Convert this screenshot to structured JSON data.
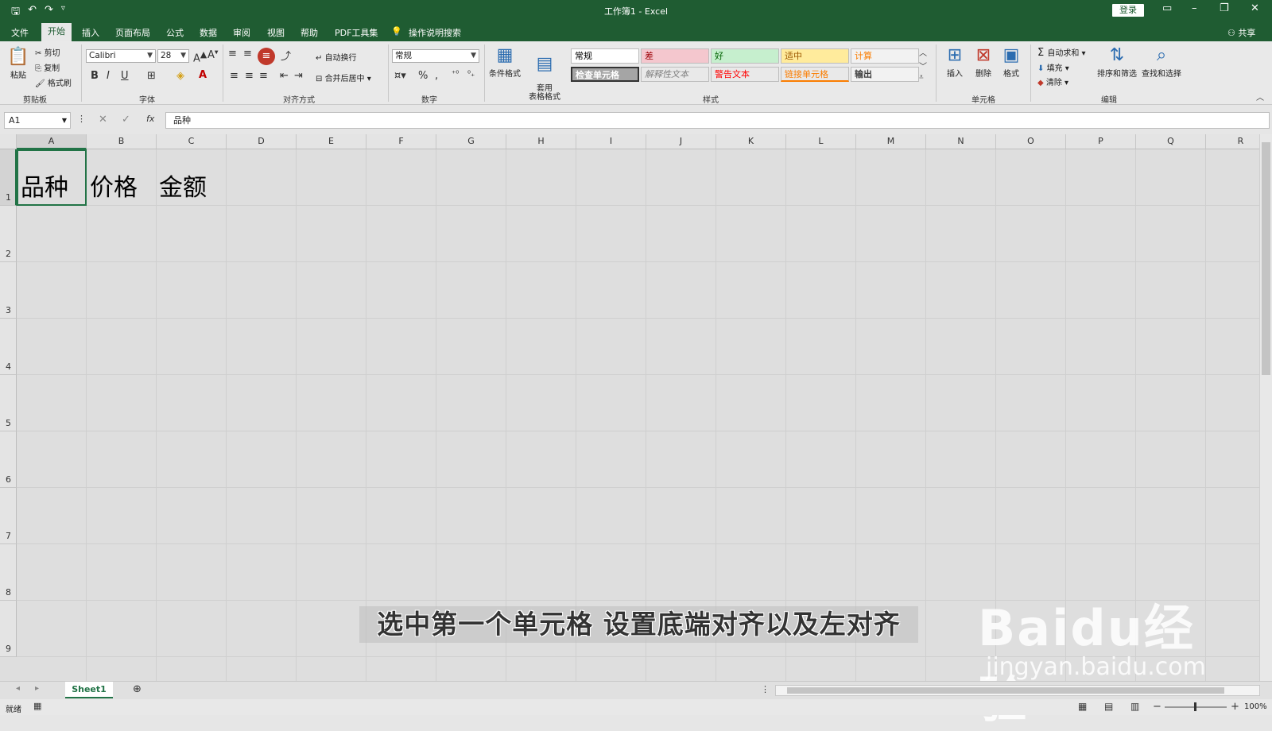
{
  "title_bar": {
    "title": "工作簿1 - Excel",
    "login": "登录"
  },
  "tabs": [
    "文件",
    "开始",
    "插入",
    "页面布局",
    "公式",
    "数据",
    "审阅",
    "视图",
    "帮助",
    "PDF工具集"
  ],
  "tell_me": "操作说明搜索",
  "share": "共享",
  "ribbon": {
    "clipboard": {
      "paste": "粘贴",
      "cut": "剪切",
      "copy": "复制",
      "format_painter": "格式刷",
      "label": "剪贴板"
    },
    "font": {
      "name": "Calibri",
      "size": "28",
      "label": "字体",
      "bold": "B",
      "italic": "I",
      "underline": "U"
    },
    "alignment": {
      "wrap": "自动换行",
      "merge": "合并后居中",
      "label": "对齐方式"
    },
    "number": {
      "format": "常规",
      "label": "数字",
      "percent": "%",
      "comma": ","
    },
    "styles": {
      "conditional": "条件格式",
      "table": "套用\n表格格式",
      "label": "样式",
      "cells": [
        {
          "text": "常规",
          "bg": "#ffffff",
          "color": "#000000"
        },
        {
          "text": "差",
          "bg": "#f4c7ce",
          "color": "#9c0006"
        },
        {
          "text": "好",
          "bg": "#c6efce",
          "color": "#006100"
        },
        {
          "text": "适中",
          "bg": "#ffeb9c",
          "color": "#9c5700"
        },
        {
          "text": "计算",
          "bg": "#f2f2f2",
          "color": "#fa7d00"
        },
        {
          "text": "检查单元格",
          "bg": "#a5a5a5",
          "color": "#ffffff"
        },
        {
          "text": "解释性文本",
          "bg": "#e9e9e9",
          "color": "#7f7f7f"
        },
        {
          "text": "警告文本",
          "bg": "#e9e9e9",
          "color": "#ff0000"
        },
        {
          "text": "链接单元格",
          "bg": "#e9e9e9",
          "color": "#fa7d00"
        },
        {
          "text": "输出",
          "bg": "#f2f2f2",
          "color": "#3f3f3f"
        }
      ]
    },
    "cells": {
      "insert": "插入",
      "delete": "删除",
      "format": "格式",
      "label": "单元格"
    },
    "editing": {
      "autosum": "自动求和",
      "fill": "填充",
      "clear": "清除",
      "sort": "排序和筛选",
      "find": "查找和选择",
      "label": "编辑"
    }
  },
  "formula_bar": {
    "name_box": "A1",
    "fx": "fx",
    "content": "品种"
  },
  "columns": [
    "A",
    "B",
    "C",
    "D",
    "E",
    "F",
    "G",
    "H",
    "I",
    "J",
    "K",
    "L",
    "M",
    "N",
    "O",
    "P",
    "Q",
    "R"
  ],
  "rows": [
    "1",
    "2",
    "3",
    "4",
    "5",
    "6",
    "7",
    "8",
    "9"
  ],
  "cells": {
    "A1": "品种",
    "B1": "价格",
    "C1": "金额"
  },
  "caption": "选中第一个单元格 设置底端对齐以及左对齐",
  "watermark": {
    "logo": "Baidu经验",
    "url": "jingyan.baidu.com"
  },
  "sheet_tab": "Sheet1",
  "status": {
    "ready": "就绪",
    "zoom": "100%"
  }
}
